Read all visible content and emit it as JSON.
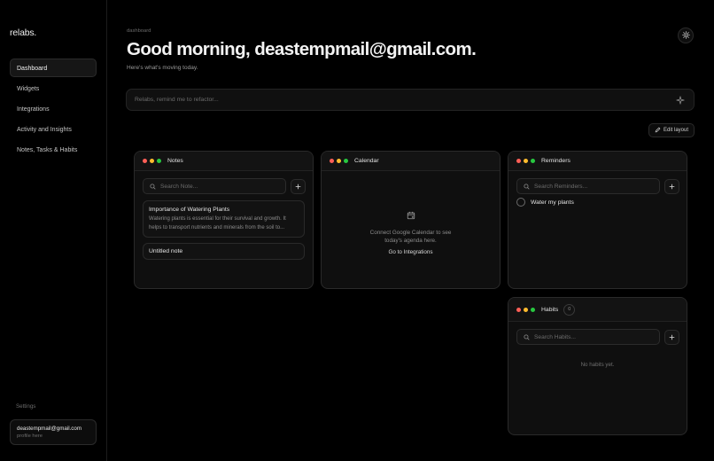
{
  "app": {
    "logo": "relabs."
  },
  "sidebar": {
    "items": [
      {
        "label": "Dashboard",
        "active": true
      },
      {
        "label": "Widgets"
      },
      {
        "label": "Integrations"
      },
      {
        "label": "Activity and Insights"
      },
      {
        "label": "Notes, Tasks & Habits"
      }
    ],
    "settings_label": "Settings",
    "profile": {
      "email": "deastempmail@gmail.com",
      "sub": "profile here"
    }
  },
  "header": {
    "breadcrumb": "dashboard",
    "title": "Good morning, deastempmail@gmail.com.",
    "subtitle": "Here's what's moving today."
  },
  "prompt": {
    "placeholder": "Relabs, remind me to refactor..."
  },
  "toolbar": {
    "edit_layout_label": "Edit layout"
  },
  "widgets": {
    "notes": {
      "title": "Notes",
      "search_placeholder": "Search Note...",
      "items": [
        {
          "title": "Importance of Watering Plants",
          "body": "Watering plants is essential for their survival and growth. It helps to transport nutrients and minerals from the soil to..."
        },
        {
          "title": "Untitled note"
        }
      ]
    },
    "calendar": {
      "title": "Calendar",
      "message": "Connect Google Calendar to see today's agenda here.",
      "link": "Go to Integrations"
    },
    "reminders": {
      "title": "Reminders",
      "search_placeholder": "Search Reminders...",
      "items": [
        {
          "label": "Water my plants"
        }
      ]
    },
    "habits": {
      "title": "Habits",
      "count": "0",
      "search_placeholder": "Search Habits...",
      "empty": "No habits yet."
    }
  },
  "colors": {
    "background": "#000000",
    "panel": "#0f0f0f",
    "dot_red": "#ff5f57",
    "dot_yellow": "#febc2e",
    "dot_green": "#28c840"
  },
  "icons": [
    "sun-icon",
    "sparkle-icon",
    "pencil-icon",
    "search-icon",
    "plus-icon",
    "calendar-plus-icon"
  ]
}
